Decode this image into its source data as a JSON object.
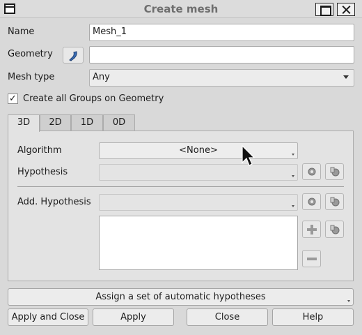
{
  "window": {
    "title": "Create mesh"
  },
  "form": {
    "name_label": "Name",
    "name_value": "Mesh_1",
    "geometry_label": "Geometry",
    "geometry_value": "",
    "mesh_type_label": "Mesh type",
    "mesh_type_value": "Any",
    "create_groups_label": "Create all Groups on Geometry",
    "create_groups_checked": "✓"
  },
  "tabs": [
    {
      "label": "3D",
      "active": true
    },
    {
      "label": "2D",
      "active": false
    },
    {
      "label": "1D",
      "active": false
    },
    {
      "label": "0D",
      "active": false
    }
  ],
  "pane": {
    "algorithm_label": "Algorithm",
    "algorithm_value": "<None>",
    "hypothesis_label": "Hypothesis",
    "hypothesis_value": "",
    "add_hypothesis_label": "Add. Hypothesis",
    "add_hypothesis_value": ""
  },
  "icons": {
    "geometry_select": "arrow-select-icon",
    "edit_hypothesis": "gear-edit-icon",
    "new_hypothesis": "gear-new-icon",
    "add": "plus-icon",
    "remove": "minus-icon"
  },
  "buttons": {
    "auto_hyp": "Assign a set of automatic hypotheses",
    "apply_close": "Apply and Close",
    "apply": "Apply",
    "close": "Close",
    "help": "Help"
  },
  "colors": {
    "accent_blue": "#3b6db3"
  }
}
